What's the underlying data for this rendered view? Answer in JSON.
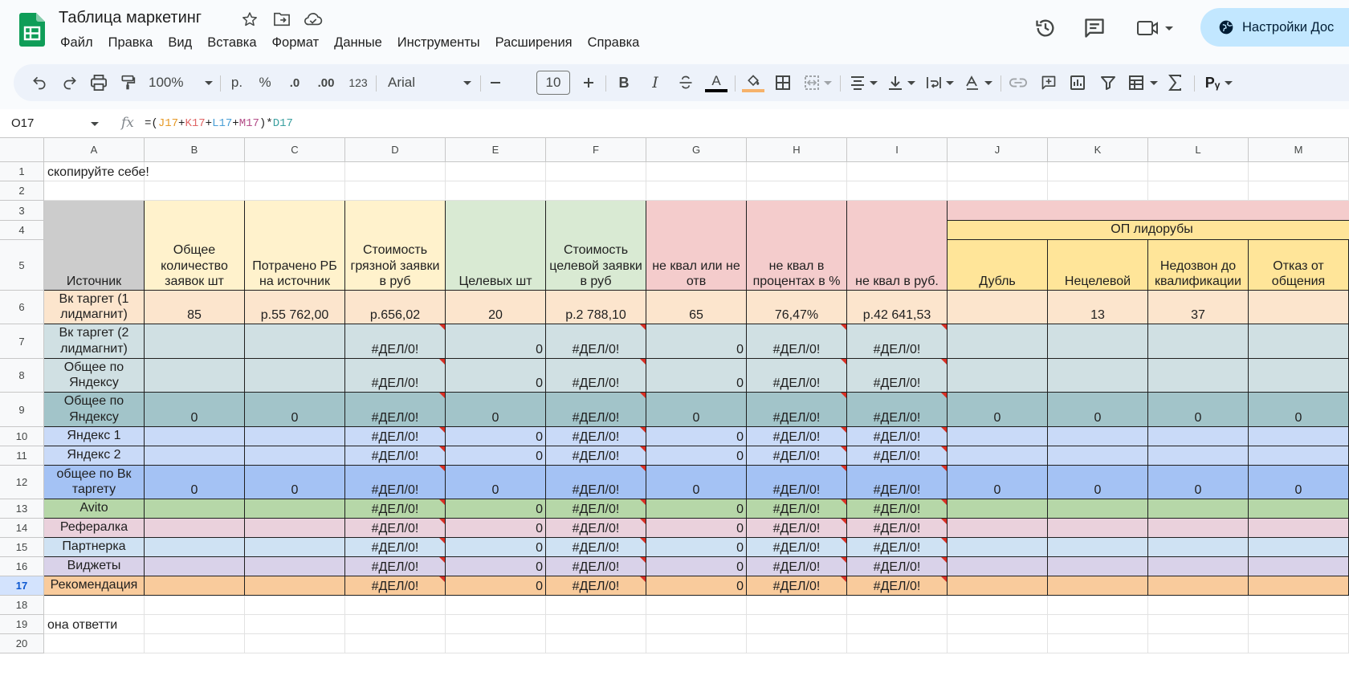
{
  "app": {
    "title": "Таблица маркетинг",
    "menu": [
      "Файл",
      "Правка",
      "Вид",
      "Вставка",
      "Формат",
      "Данные",
      "Инструменты",
      "Расширения",
      "Справка"
    ],
    "share_label": "Настройки Дос",
    "brand_color": "#0f9d58"
  },
  "toolbar": {
    "zoom": "100%",
    "currency": "р.",
    "percent": "%",
    "dec_decrease": ".0",
    "dec_increase": ".00",
    "number_format": "123",
    "font": "Arial",
    "font_size": "10",
    "bold": "B",
    "italic": "I",
    "text_color_glyph": "A",
    "fill_color": "#f6b26b"
  },
  "formula_bar": {
    "cell_ref": "O17",
    "formula_parts": [
      {
        "text": "=(",
        "color": "#1f1f1f"
      },
      {
        "text": "J17",
        "color": "#e69a28"
      },
      {
        "text": "+",
        "color": "#1f1f1f"
      },
      {
        "text": "K17",
        "color": "#e06666"
      },
      {
        "text": "+",
        "color": "#1f1f1f"
      },
      {
        "text": "L17",
        "color": "#4a9fd6"
      },
      {
        "text": "+",
        "color": "#1f1f1f"
      },
      {
        "text": "M17",
        "color": "#b5508a"
      },
      {
        "text": ")*",
        "color": "#1f1f1f"
      },
      {
        "text": "D17",
        "color": "#3aa0a0"
      }
    ]
  },
  "columns": [
    "A",
    "B",
    "C",
    "D",
    "E",
    "F",
    "G",
    "H",
    "I",
    "J",
    "K",
    "L",
    "M"
  ],
  "rows": [
    "1",
    "2",
    "3",
    "4",
    "5",
    "6",
    "7",
    "8",
    "9",
    "10",
    "11",
    "12",
    "13",
    "14",
    "15",
    "16",
    "17",
    "18",
    "19",
    "20"
  ],
  "active_row": "17",
  "sheet": {
    "A1": "скопируйте себе!",
    "A19": "она ответти",
    "op_group": "ОП лидорубы",
    "headers": {
      "A": "Источник",
      "B": "Общее количество заявок шт",
      "C": "Потрачено РБ на источник",
      "D": "Стоимость грязной заявки в руб",
      "E": "Целевых шт",
      "F": "Стоимость целевой заявки в руб",
      "G": "не квал или не отв",
      "H": "не квал в процентах в %",
      "I": "не квал в руб.",
      "J": "Дубль",
      "K": "Нецелевой",
      "L": "Недозвон до квалификации",
      "M": "Отказ от общения"
    },
    "data_rows": [
      {
        "row": "6",
        "fill": "#fce5cd",
        "cells": [
          "Вк таргет (1 лидмагнит)",
          "85",
          "р.55 762,00",
          "р.656,02",
          "20",
          "р.2 788,10",
          "65",
          "76,47%",
          "р.42 641,53",
          "",
          "13",
          "37",
          ""
        ]
      },
      {
        "row": "7",
        "fill": "#d0e0e3",
        "cells": [
          "Вк таргет (2 лидмагнит)",
          "",
          "",
          "#ДЕЛ/0!",
          "0",
          "#ДЕЛ/0!",
          "0",
          "#ДЕЛ/0!",
          "#ДЕЛ/0!",
          "",
          "",
          "",
          ""
        ]
      },
      {
        "row": "8",
        "fill": "#d0e0e3",
        "cells": [
          "Общее по Яндексу",
          "",
          "",
          "#ДЕЛ/0!",
          "0",
          "#ДЕЛ/0!",
          "0",
          "#ДЕЛ/0!",
          "#ДЕЛ/0!",
          "",
          "",
          "",
          ""
        ]
      },
      {
        "row": "9",
        "fill": "#a2c4c9",
        "cells": [
          "Общее по Яндексу",
          "0",
          "0",
          "#ДЕЛ/0!",
          "0",
          "#ДЕЛ/0!",
          "0",
          "#ДЕЛ/0!",
          "#ДЕЛ/0!",
          "0",
          "0",
          "0",
          "0"
        ]
      },
      {
        "row": "10",
        "fill": "#c9daf8",
        "cells": [
          "Яндекс 1",
          "",
          "",
          "#ДЕЛ/0!",
          "0",
          "#ДЕЛ/0!",
          "0",
          "#ДЕЛ/0!",
          "#ДЕЛ/0!",
          "",
          "",
          "",
          ""
        ]
      },
      {
        "row": "11",
        "fill": "#c9daf8",
        "cells": [
          "Яндекс 2",
          "",
          "",
          "#ДЕЛ/0!",
          "0",
          "#ДЕЛ/0!",
          "0",
          "#ДЕЛ/0!",
          "#ДЕЛ/0!",
          "",
          "",
          "",
          ""
        ]
      },
      {
        "row": "12",
        "fill": "#a4c2f4",
        "cells": [
          "общее по Вк таргету",
          "0",
          "0",
          "#ДЕЛ/0!",
          "0",
          "#ДЕЛ/0!",
          "0",
          "#ДЕЛ/0!",
          "#ДЕЛ/0!",
          "0",
          "0",
          "0",
          "0"
        ]
      },
      {
        "row": "13",
        "fill": "#b6d7a8",
        "cells": [
          "Avito",
          "",
          "",
          "#ДЕЛ/0!",
          "0",
          "#ДЕЛ/0!",
          "0",
          "#ДЕЛ/0!",
          "#ДЕЛ/0!",
          "",
          "",
          "",
          ""
        ]
      },
      {
        "row": "14",
        "fill": "#ead1dc",
        "cells": [
          "Рефералка",
          "",
          "",
          "#ДЕЛ/0!",
          "0",
          "#ДЕЛ/0!",
          "0",
          "#ДЕЛ/0!",
          "#ДЕЛ/0!",
          "",
          "",
          "",
          ""
        ]
      },
      {
        "row": "15",
        "fill": "#cfe2f3",
        "cells": [
          "Партнерка",
          "",
          "",
          "#ДЕЛ/0!",
          "0",
          "#ДЕЛ/0!",
          "0",
          "#ДЕЛ/0!",
          "#ДЕЛ/0!",
          "",
          "",
          "",
          ""
        ]
      },
      {
        "row": "16",
        "fill": "#d9d2e9",
        "cells": [
          "Виджеты",
          "",
          "",
          "#ДЕЛ/0!",
          "0",
          "#ДЕЛ/0!",
          "0",
          "#ДЕЛ/0!",
          "#ДЕЛ/0!",
          "",
          "",
          "",
          ""
        ]
      },
      {
        "row": "17",
        "fill": "#f9cb9c",
        "cells": [
          "Рекомендация",
          "",
          "",
          "#ДЕЛ/0!",
          "0",
          "#ДЕЛ/0!",
          "0",
          "#ДЕЛ/0!",
          "#ДЕЛ/0!",
          "",
          "",
          "",
          ""
        ]
      }
    ],
    "header_fills": {
      "A": "#cccccc",
      "B": "#fff2cc",
      "C": "#fff2cc",
      "D": "#fff2cc",
      "E": "#d9ead3",
      "F": "#d9ead3",
      "G": "#f4cccc",
      "H": "#f4cccc",
      "I": "#f4cccc",
      "group": "#f4cccc",
      "op": "#ffe599"
    }
  }
}
